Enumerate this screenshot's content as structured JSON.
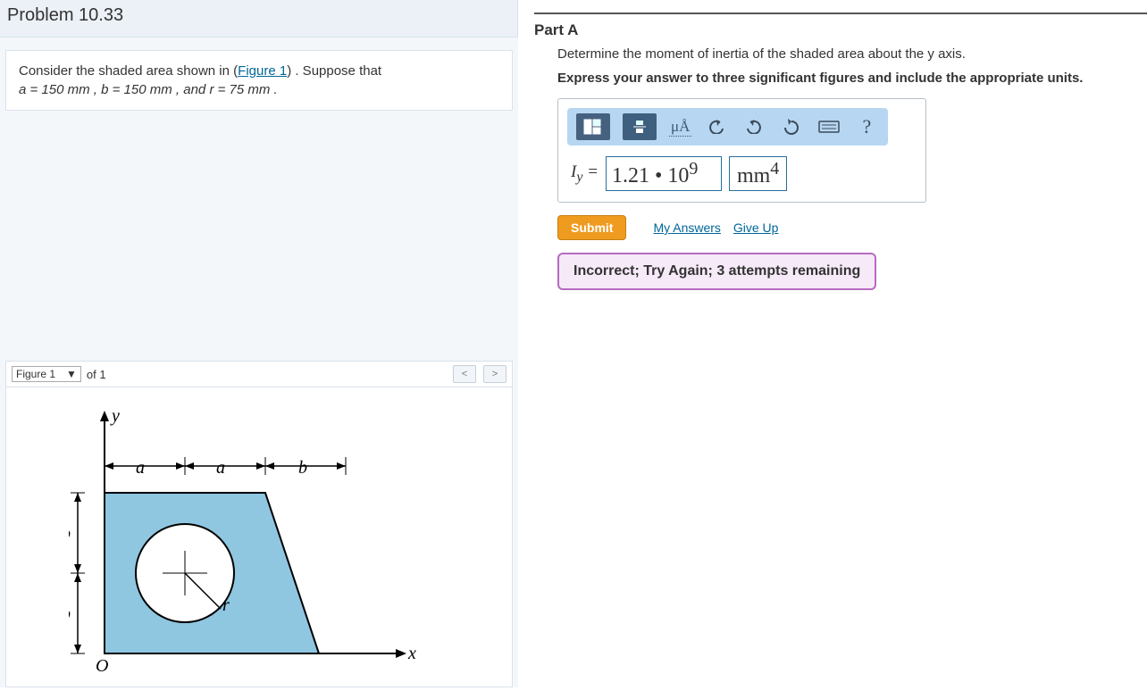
{
  "problem": {
    "title": "Problem 10.33",
    "text_prefix": "Consider the shaded area shown in (",
    "figure_link": "Figure 1",
    "text_suffix": ") . Suppose that ",
    "params_line": "a = 150  mm , b = 150  mm , and r = 75  mm ."
  },
  "figure": {
    "selector_label": "Figure 1",
    "of_label": "of 1",
    "labels": {
      "y": "y",
      "x": "x",
      "a": "a",
      "b": "b",
      "r": "r",
      "O": "O"
    }
  },
  "part": {
    "title": "Part A",
    "question": "Determine the moment of inertia of the shaded area about the y axis.",
    "hint": "Express your answer to three significant figures and include the appropriate units.",
    "var_label": "I",
    "var_sub": "y",
    "equals": " = ",
    "answer_value": "1.21 • 10",
    "answer_exp": "9",
    "unit_value": "mm",
    "unit_exp": "4",
    "submit_label": "Submit",
    "my_answers": "My Answers",
    "give_up": "Give Up",
    "feedback": "Incorrect; Try Again; 3 attempts remaining",
    "toolbar": {
      "uA": "μÅ",
      "help": "?"
    }
  }
}
